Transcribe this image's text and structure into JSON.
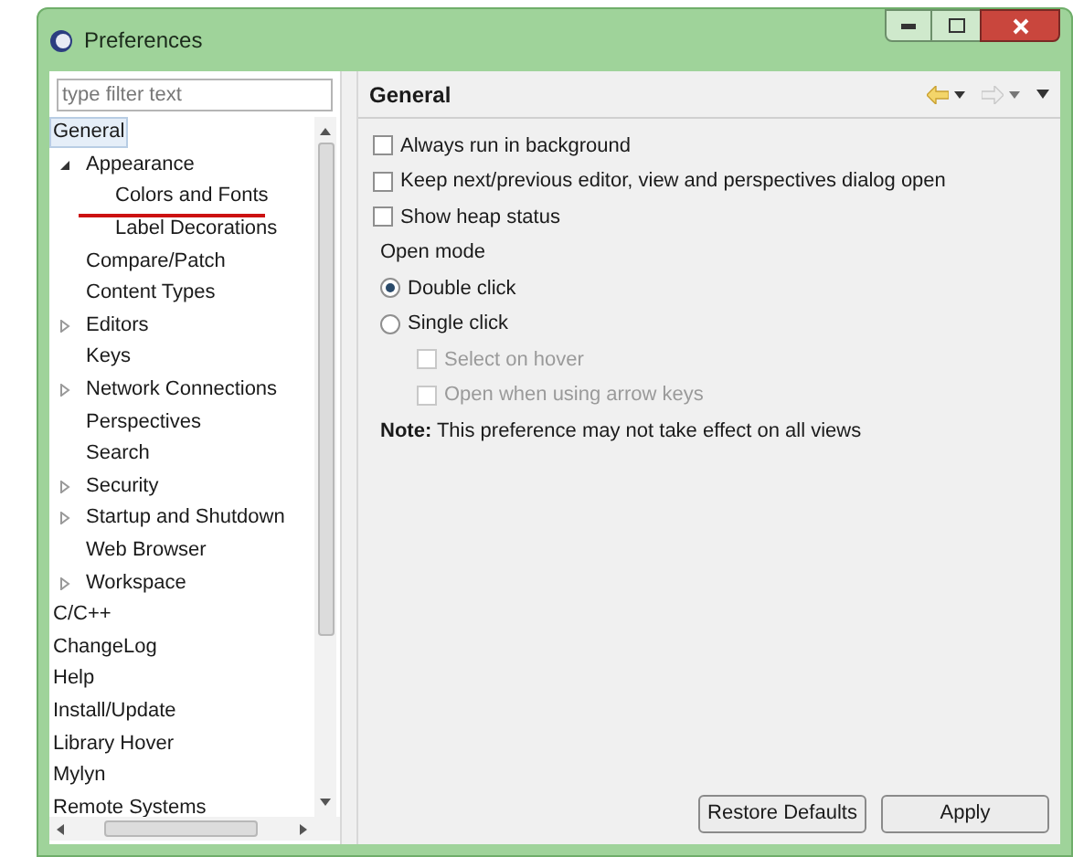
{
  "window": {
    "title": "Preferences"
  },
  "filter": {
    "placeholder": "type filter text"
  },
  "tree": [
    {
      "label": "General",
      "kind": "root",
      "selected": true,
      "annotated": false,
      "children": [
        {
          "label": "Appearance",
          "kind": "branch",
          "expanded": true,
          "selected": false,
          "annotated": false,
          "children": [
            {
              "label": "Colors and Fonts",
              "kind": "leaf",
              "selected": false,
              "annotated": true
            },
            {
              "label": "Label Decorations",
              "kind": "leaf",
              "selected": false,
              "annotated": false
            }
          ]
        },
        {
          "label": "Compare/Patch",
          "kind": "leaf",
          "selected": false,
          "annotated": false
        },
        {
          "label": "Content Types",
          "kind": "leaf",
          "selected": false,
          "annotated": false
        },
        {
          "label": "Editors",
          "kind": "branch",
          "expanded": false,
          "selected": false,
          "annotated": false
        },
        {
          "label": "Keys",
          "kind": "leaf",
          "selected": false,
          "annotated": false
        },
        {
          "label": "Network Connections",
          "kind": "branch",
          "expanded": false,
          "selected": false,
          "annotated": false
        },
        {
          "label": "Perspectives",
          "kind": "leaf",
          "selected": false,
          "annotated": false
        },
        {
          "label": "Search",
          "kind": "leaf",
          "selected": false,
          "annotated": false
        },
        {
          "label": "Security",
          "kind": "branch",
          "expanded": false,
          "selected": false,
          "annotated": false
        },
        {
          "label": "Startup and Shutdown",
          "kind": "branch",
          "expanded": false,
          "selected": false,
          "annotated": false
        },
        {
          "label": "Web Browser",
          "kind": "leaf",
          "selected": false,
          "annotated": false
        },
        {
          "label": "Workspace",
          "kind": "branch",
          "expanded": false,
          "selected": false,
          "annotated": false
        }
      ]
    },
    {
      "label": "C/C++",
      "kind": "root",
      "selected": false,
      "annotated": false
    },
    {
      "label": "ChangeLog",
      "kind": "root",
      "selected": false,
      "annotated": false
    },
    {
      "label": "Help",
      "kind": "root",
      "selected": false,
      "annotated": false
    },
    {
      "label": "Install/Update",
      "kind": "root",
      "selected": false,
      "annotated": false
    },
    {
      "label": "Library Hover",
      "kind": "root",
      "selected": false,
      "annotated": false
    },
    {
      "label": "Mylyn",
      "kind": "root",
      "selected": false,
      "annotated": false
    },
    {
      "label": "Remote Systems",
      "kind": "root",
      "selected": false,
      "annotated": false
    }
  ],
  "page": {
    "title": "General",
    "options": [
      {
        "kind": "checkbox",
        "label": "Always run in background",
        "checked": false,
        "disabled": false,
        "indented": false
      },
      {
        "kind": "checkbox",
        "label": "Keep next/previous editor, view and perspectives dialog open",
        "checked": false,
        "disabled": false,
        "indented": false
      },
      {
        "kind": "checkbox",
        "label": "Show heap status",
        "checked": false,
        "disabled": false,
        "indented": false
      },
      {
        "kind": "heading",
        "label": "Open mode"
      },
      {
        "kind": "radio",
        "label": "Double click",
        "checked": true,
        "disabled": false,
        "indented": false
      },
      {
        "kind": "radio",
        "label": "Single click",
        "checked": false,
        "disabled": false,
        "indented": false
      },
      {
        "kind": "checkbox",
        "label": "Select on hover",
        "checked": false,
        "disabled": true,
        "indented": true
      },
      {
        "kind": "checkbox",
        "label": "Open when using arrow keys",
        "checked": false,
        "disabled": true,
        "indented": true
      }
    ],
    "note": "**Note:** This preference may not take effect on all views"
  },
  "buttons": [
    "Restore Defaults",
    "Apply"
  ]
}
